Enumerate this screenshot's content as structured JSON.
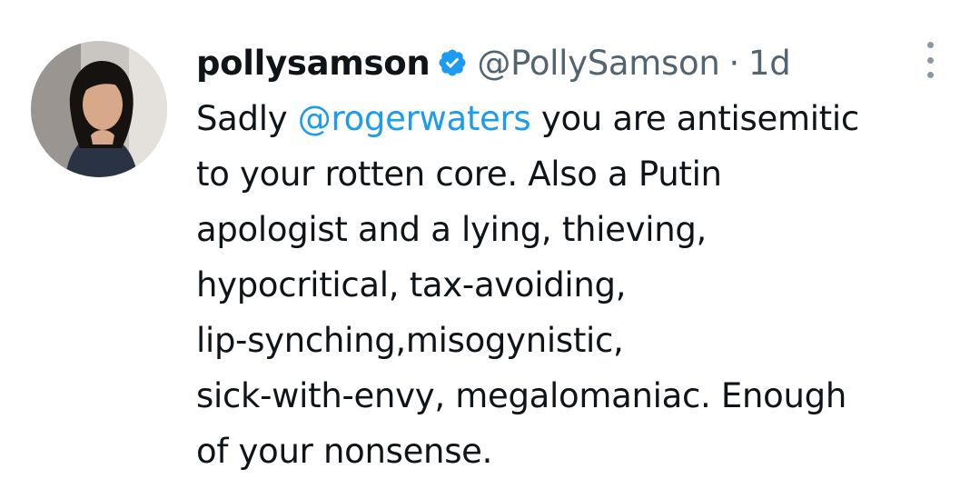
{
  "tweet": {
    "display_name": "pollysamson",
    "verified_icon": "verified-badge-icon",
    "handle": "@PollySamson",
    "separator": "·",
    "time": "1d",
    "more_icon": "more-vertical-icon",
    "avatar_icon": "user-avatar",
    "text": {
      "line1_start": "Sadly ",
      "mention": "@rogerwaters",
      "line1_end": " you are antisemitic",
      "line2": "to your rotten core. Also a Putin",
      "line3": "apologist and a lying, thieving,",
      "line4": "hypocritical, tax-avoiding,",
      "line5": "lip-synching,misogynistic,",
      "line6": "sick-with-envy, megalomaniac. Enough",
      "line7": "of your nonsense."
    }
  },
  "colors": {
    "text": "#0f1419",
    "secondary": "#536471",
    "link": "#1d9bf0",
    "verified": "#1d9bf0"
  }
}
